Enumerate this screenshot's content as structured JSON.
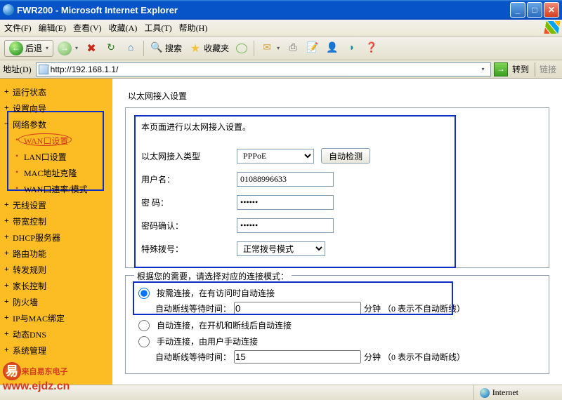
{
  "window": {
    "title": "FWR200 - Microsoft Internet Explorer"
  },
  "menubar": {
    "file": "文件(F)",
    "edit": "编辑(E)",
    "view": "查看(V)",
    "favorites": "收藏(A)",
    "tools": "工具(T)",
    "help": "帮助(H)"
  },
  "toolbar": {
    "back": "后退",
    "search": "搜索",
    "favorites": "收藏夹"
  },
  "address": {
    "label": "地址(D)",
    "url": "http://192.168.1.1/",
    "go": "转到",
    "links": "链接"
  },
  "sidebar": {
    "items": [
      {
        "label": "运行状态",
        "lv": 1
      },
      {
        "label": "设置向导",
        "lv": 1
      },
      {
        "label": "网络参数",
        "lv": 1,
        "exp": true
      },
      {
        "label": "WAN口设置",
        "lv": 2,
        "sel": true
      },
      {
        "label": "LAN口设置",
        "lv": 2
      },
      {
        "label": "MAC地址克隆",
        "lv": 2
      },
      {
        "label": "WAN口速率/模式",
        "lv": 2
      },
      {
        "label": "无线设置",
        "lv": 1
      },
      {
        "label": "带宽控制",
        "lv": 1
      },
      {
        "label": "DHCP服务器",
        "lv": 1
      },
      {
        "label": "路由功能",
        "lv": 1
      },
      {
        "label": "转发规则",
        "lv": 1
      },
      {
        "label": "家长控制",
        "lv": 1
      },
      {
        "label": "防火墙",
        "lv": 1
      },
      {
        "label": "IP与MAC绑定",
        "lv": 1
      },
      {
        "label": "动态DNS",
        "lv": 1
      },
      {
        "label": "系统管理",
        "lv": 1
      }
    ]
  },
  "page": {
    "title": "以太网接入设置",
    "desc": "本页面进行以太网接入设置。",
    "type_label": "以太网接入类型",
    "type_value": "PPPoE",
    "auto_detect": "自动检测",
    "user_label": "用户名：",
    "user_value": "01088996633",
    "pwd_label": "密 码：",
    "pwd_value": "••••••",
    "pwd2_label": "密码确认：",
    "pwd2_value": "••••••",
    "special_label": "特殊拨号：",
    "special_value": "正常拨号模式",
    "conn_legend": "根据您的需要，请选择对应的连接模式：",
    "opt1": "按需连接，在有访问时自动连接",
    "opt1_wait_label": "自动断线等待时间：",
    "opt1_wait_value": "0",
    "opt1_wait_unit": "分钟 （0 表示不自动断线）",
    "opt2": "自动连接，在开机和断线后自动连接",
    "opt3": "手动连接，由用户手动连接",
    "opt3_wait_label": "自动断线等待时间：",
    "opt3_wait_value": "15",
    "opt3_wait_unit": "分钟 （0 表示不自动断线）"
  },
  "status": {
    "zone": "Internet"
  },
  "watermark": {
    "line1": "来自易东电子",
    "line2": "www.ejdz.cn"
  }
}
